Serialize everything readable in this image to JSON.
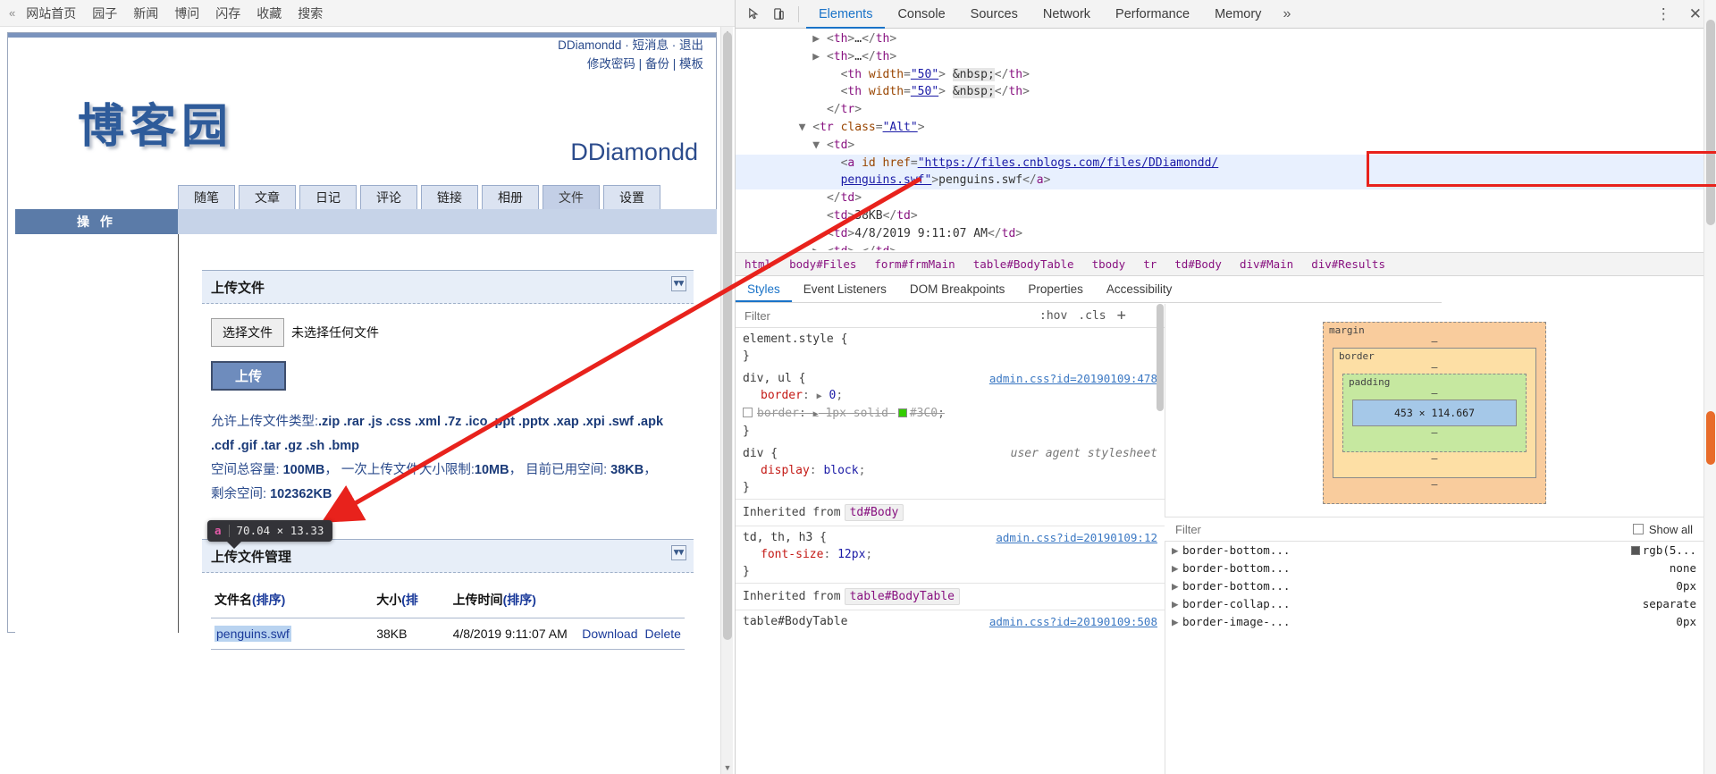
{
  "cnblogs_nav": {
    "chevron": "«",
    "items": [
      "网站首页",
      "园子",
      "新闻",
      "博问",
      "闪存",
      "收藏",
      "搜索"
    ]
  },
  "site": {
    "user": {
      "name": "DDiamondd",
      "sep": "·",
      "message_link": "短消息",
      "logout_link": "退出",
      "change_password": "修改密码",
      "pipe": "|",
      "backup": "备份",
      "template": "模板"
    },
    "logo_text": "博客园",
    "blog_name": "DDiamondd",
    "tabs": [
      {
        "label": "随笔",
        "selected": false
      },
      {
        "label": "文章",
        "selected": false
      },
      {
        "label": "日记",
        "selected": false
      },
      {
        "label": "评论",
        "selected": false
      },
      {
        "label": "链接",
        "selected": false
      },
      {
        "label": "相册",
        "selected": false
      },
      {
        "label": "文件",
        "selected": true
      },
      {
        "label": "设置",
        "selected": false
      }
    ],
    "op_bar_label": "操 作"
  },
  "upload_panel": {
    "title": "上传文件",
    "toggle_icon": "chevron-double-down",
    "choose_button": "选择文件",
    "no_file_text": "未选择任何文件",
    "upload_button": "上传",
    "allowed_label": "允许上传文件类型:",
    "allowed_types_line1": ".zip .rar .js .css .xml .7z .ico .ppt .pptx .xap .xpi .swf .apk",
    "allowed_types_line2": ".cdf .gif .tar .gz .sh .bmp",
    "quota_prefix": "空间总容量:",
    "quota_total": "100MB",
    "quota_sep1": "，",
    "single_limit_label": "一次上传文件大小限制:",
    "single_limit_value": "10MB",
    "quota_sep2": "，",
    "used_label": "目前已用空间:",
    "used_value": "38KB",
    "used_sep": "，",
    "remain_label": "剩余空间:",
    "remain_value": "102362KB"
  },
  "manage_panel": {
    "title": "上传文件管理",
    "toggle_icon": "chevron-double-down",
    "columns": [
      {
        "label": "文件名",
        "sort": "(排序)"
      },
      {
        "label": "大小",
        "sort": "(排"
      },
      {
        "label": "上传时间",
        "sort": "(排序)"
      }
    ],
    "rows": [
      {
        "name": "penguins.swf",
        "size": "38KB",
        "time": "4/8/2019 9:11:07 AM",
        "download": "Download",
        "delete": "Delete"
      }
    ]
  },
  "inspector_tooltip": {
    "tag": "a",
    "dimensions": "70.04 × 13.33"
  },
  "devtools": {
    "toolbar_icons": [
      "inspect-cursor-icon",
      "device-toolbar-icon"
    ],
    "tabs": [
      {
        "label": "Elements",
        "active": true
      },
      {
        "label": "Console",
        "active": false
      },
      {
        "label": "Sources",
        "active": false
      },
      {
        "label": "Network",
        "active": false
      },
      {
        "label": "Performance",
        "active": false
      },
      {
        "label": "Memory",
        "active": false
      }
    ],
    "more_tabs_icon": "»",
    "kebab_icon": "⋮",
    "close_icon": "✕",
    "dom_lines": [
      {
        "indent": 5,
        "triangle": "▶",
        "parts": [
          {
            "t": "punct",
            "v": "<"
          },
          {
            "t": "tag",
            "v": "th"
          },
          {
            "t": "punct",
            "v": ">"
          },
          {
            "t": "text",
            "v": "…"
          },
          {
            "t": "punct",
            "v": "</"
          },
          {
            "t": "tag",
            "v": "th"
          },
          {
            "t": "punct",
            "v": ">"
          }
        ]
      },
      {
        "indent": 5,
        "triangle": "▶",
        "parts": [
          {
            "t": "punct",
            "v": "<"
          },
          {
            "t": "tag",
            "v": "th"
          },
          {
            "t": "punct",
            "v": ">"
          },
          {
            "t": "text",
            "v": "…"
          },
          {
            "t": "punct",
            "v": "</"
          },
          {
            "t": "tag",
            "v": "th"
          },
          {
            "t": "punct",
            "v": ">"
          }
        ]
      },
      {
        "indent": 6,
        "triangle": "",
        "parts": [
          {
            "t": "punct",
            "v": "<"
          },
          {
            "t": "tag",
            "v": "th"
          },
          {
            "t": "text",
            "v": " "
          },
          {
            "t": "attr",
            "v": "width"
          },
          {
            "t": "punct",
            "v": "="
          },
          {
            "t": "val",
            "v": "\"50\""
          },
          {
            "t": "punct",
            "v": "> "
          },
          {
            "t": "ent",
            "v": "&nbsp;"
          },
          {
            "t": "punct",
            "v": "</"
          },
          {
            "t": "tag",
            "v": "th"
          },
          {
            "t": "punct",
            "v": ">"
          }
        ]
      },
      {
        "indent": 6,
        "triangle": "",
        "parts": [
          {
            "t": "punct",
            "v": "<"
          },
          {
            "t": "tag",
            "v": "th"
          },
          {
            "t": "text",
            "v": " "
          },
          {
            "t": "attr",
            "v": "width"
          },
          {
            "t": "punct",
            "v": "="
          },
          {
            "t": "val",
            "v": "\"50\""
          },
          {
            "t": "punct",
            "v": "> "
          },
          {
            "t": "ent",
            "v": "&nbsp;"
          },
          {
            "t": "punct",
            "v": "</"
          },
          {
            "t": "tag",
            "v": "th"
          },
          {
            "t": "punct",
            "v": ">"
          }
        ]
      },
      {
        "indent": 5,
        "triangle": "",
        "parts": [
          {
            "t": "punct",
            "v": "</"
          },
          {
            "t": "tag",
            "v": "tr"
          },
          {
            "t": "punct",
            "v": ">"
          }
        ]
      },
      {
        "indent": 4,
        "triangle": "▼",
        "parts": [
          {
            "t": "punct",
            "v": "<"
          },
          {
            "t": "tag",
            "v": "tr"
          },
          {
            "t": "text",
            "v": " "
          },
          {
            "t": "attr",
            "v": "class"
          },
          {
            "t": "punct",
            "v": "="
          },
          {
            "t": "val",
            "v": "\"Alt\""
          },
          {
            "t": "punct",
            "v": ">"
          }
        ]
      },
      {
        "indent": 5,
        "triangle": "▼",
        "parts": [
          {
            "t": "punct",
            "v": "<"
          },
          {
            "t": "tag",
            "v": "td"
          },
          {
            "t": "punct",
            "v": ">"
          }
        ]
      },
      {
        "indent": 6,
        "triangle": "",
        "highlight": true,
        "parts": [
          {
            "t": "punct",
            "v": "<"
          },
          {
            "t": "tag",
            "v": "a"
          },
          {
            "t": "text",
            "v": " "
          },
          {
            "t": "attr",
            "v": "id"
          },
          {
            "t": "text",
            "v": " "
          },
          {
            "t": "attr",
            "v": "href"
          },
          {
            "t": "punct",
            "v": "="
          },
          {
            "t": "val",
            "v": "\"https://files.cnblogs.com/files/DDiamondd/"
          }
        ]
      },
      {
        "indent": 6,
        "triangle": "",
        "highlight": true,
        "parts": [
          {
            "t": "val",
            "v": "penguins.swf\""
          },
          {
            "t": "punct",
            "v": ">"
          },
          {
            "t": "text",
            "v": "penguins.swf"
          },
          {
            "t": "punct",
            "v": "</"
          },
          {
            "t": "tag",
            "v": "a"
          },
          {
            "t": "punct",
            "v": ">"
          }
        ]
      },
      {
        "indent": 5,
        "triangle": "",
        "parts": [
          {
            "t": "punct",
            "v": "</"
          },
          {
            "t": "tag",
            "v": "td"
          },
          {
            "t": "punct",
            "v": ">"
          }
        ]
      },
      {
        "indent": 5,
        "triangle": "",
        "parts": [
          {
            "t": "punct",
            "v": "<"
          },
          {
            "t": "tag",
            "v": "td"
          },
          {
            "t": "punct",
            "v": ">"
          },
          {
            "t": "text",
            "v": "38KB"
          },
          {
            "t": "punct",
            "v": "</"
          },
          {
            "t": "tag",
            "v": "td"
          },
          {
            "t": "punct",
            "v": ">"
          }
        ]
      },
      {
        "indent": 5,
        "triangle": "",
        "parts": [
          {
            "t": "punct",
            "v": "<"
          },
          {
            "t": "tag",
            "v": "td"
          },
          {
            "t": "punct",
            "v": ">"
          },
          {
            "t": "text",
            "v": "4/8/2019 9:11:07 AM"
          },
          {
            "t": "punct",
            "v": "</"
          },
          {
            "t": "tag",
            "v": "td"
          },
          {
            "t": "punct",
            "v": ">"
          }
        ]
      },
      {
        "indent": 5,
        "triangle": "▶",
        "parts": [
          {
            "t": "punct",
            "v": "<"
          },
          {
            "t": "tag",
            "v": "td"
          },
          {
            "t": "punct",
            "v": ">"
          },
          {
            "t": "text",
            "v": "…"
          },
          {
            "t": "punct",
            "v": "</"
          },
          {
            "t": "tag",
            "v": "td"
          },
          {
            "t": "punct",
            "v": ">"
          }
        ]
      }
    ],
    "breadcrumb": [
      {
        "label": "html",
        "type": "tag"
      },
      {
        "label": "body#Files",
        "type": "tag"
      },
      {
        "label": "form#frmMain",
        "type": "tag"
      },
      {
        "label": "table#BodyTable",
        "type": "tag"
      },
      {
        "label": "tbody",
        "type": "tag"
      },
      {
        "label": "tr",
        "type": "tag"
      },
      {
        "label": "td#Body",
        "type": "tag"
      },
      {
        "label": "div#Main",
        "type": "tag"
      },
      {
        "label": "div#Results",
        "type": "tag"
      }
    ],
    "styles_tabs": [
      {
        "label": "Styles",
        "active": true
      },
      {
        "label": "Event Listeners",
        "active": false
      },
      {
        "label": "DOM Breakpoints",
        "active": false
      },
      {
        "label": "Properties",
        "active": false
      },
      {
        "label": "Accessibility",
        "active": false
      }
    ],
    "filter_placeholder": "Filter",
    "hov_label": ":hov",
    "cls_label": ".cls",
    "plus_label": "+",
    "rules": [
      {
        "selector": "element.style {",
        "source": "",
        "props": [],
        "close": "}"
      },
      {
        "selector": "div, ul {",
        "source": "admin.css?id=20190109:478",
        "props": [
          {
            "name": "border",
            "value": "0",
            "arrow": true,
            "strike": false,
            "checkbox": false
          },
          {
            "name": "border",
            "value": "1px solid #3C0",
            "arrow": true,
            "strike": true,
            "checkbox": true,
            "swatch": "#33CC00"
          }
        ],
        "close": "}"
      },
      {
        "selector": "div {",
        "source": "",
        "ua": "user agent stylesheet",
        "props": [
          {
            "name": "display",
            "value": "block",
            "arrow": false,
            "strike": false,
            "checkbox": false
          }
        ],
        "close": "}"
      }
    ],
    "inherited_1": {
      "text": "Inherited from",
      "chip": "td#Body"
    },
    "rule_inherited_1": {
      "selector": "td, th, h3 {",
      "source": "admin.css?id=20190109:12",
      "props": [
        {
          "name": "font-size",
          "value": "12px",
          "arrow": false,
          "strike": false,
          "checkbox": false
        }
      ],
      "close": "}"
    },
    "inherited_2": {
      "text": "Inherited from",
      "chip": "table#BodyTable"
    },
    "rule_inherited_2": {
      "selector": "table#BodyTable",
      "source": "admin.css?id=20190109:508"
    },
    "box_model": {
      "margin_label": "margin",
      "margin_value": "–",
      "border_label": "border",
      "border_value": "–",
      "padding_label": "padding",
      "padding_value": "–",
      "content": "453 × 114.667",
      "dashes": [
        "–",
        "–",
        "–",
        "–"
      ]
    },
    "computed_filter_placeholder": "Filter",
    "show_all_label": "Show all",
    "computed": [
      {
        "name": "border-bottom...",
        "value": "rgb(5...",
        "swatch": "#555555"
      },
      {
        "name": "border-bottom...",
        "value": "none",
        "swatch": null
      },
      {
        "name": "border-bottom...",
        "value": "0px",
        "swatch": null
      },
      {
        "name": "border-collap...",
        "value": "separate",
        "swatch": null
      },
      {
        "name": "border-image-...",
        "value": "0px",
        "swatch": null
      }
    ]
  },
  "colors": {
    "accent_blue": "#1a73c8",
    "site_blue": "#2b4b8c",
    "red_highlight": "#e8221c",
    "tab_selected_bg": "#c3cfe6",
    "opbar_bg": "#5b7ba8"
  }
}
